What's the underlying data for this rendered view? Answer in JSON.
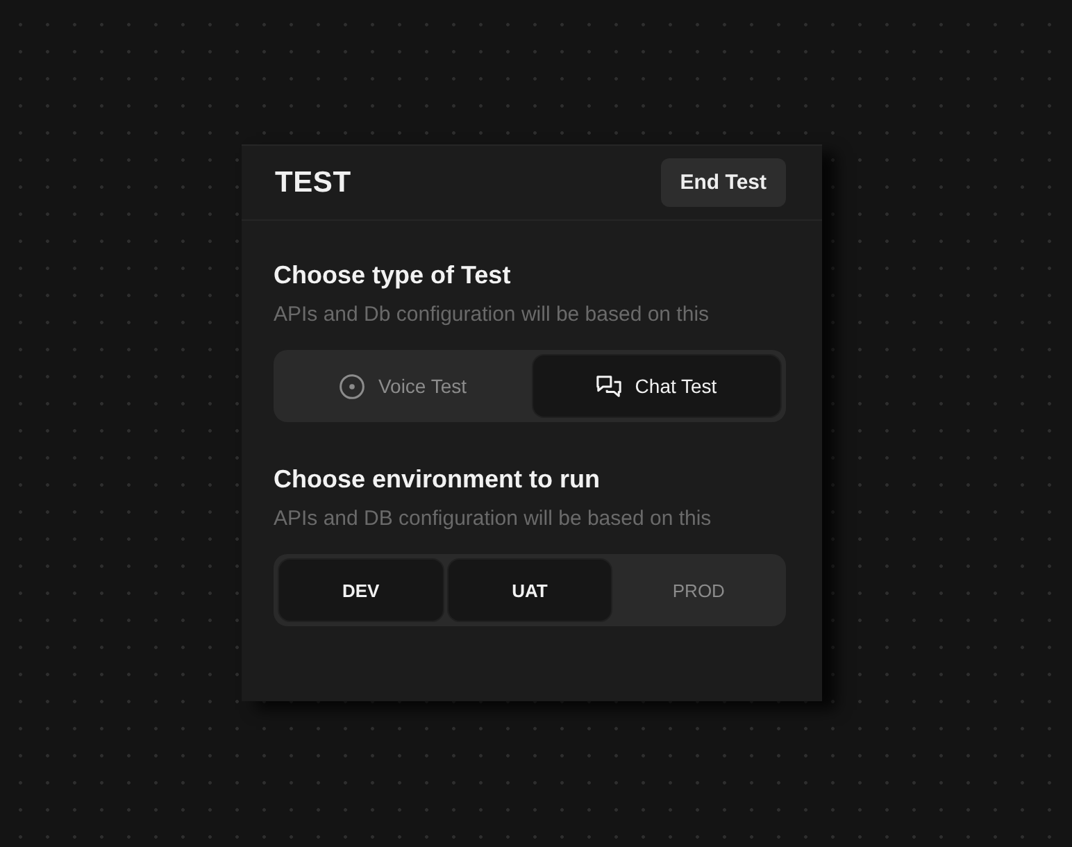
{
  "panel": {
    "title": "TEST",
    "end_button": "End Test"
  },
  "sections": [
    {
      "title": "Choose type of Test",
      "subtitle": "APIs and Db configuration will be based on this",
      "options": [
        {
          "label": "Voice Test",
          "kind": "voice",
          "selected": false
        },
        {
          "label": "Chat Test",
          "kind": "chat",
          "selected": true
        }
      ]
    },
    {
      "title": "Choose environment to run",
      "subtitle": "APIs and DB configuration will be based on this",
      "options": [
        {
          "label": "DEV",
          "selected": true
        },
        {
          "label": "UAT",
          "selected": true
        },
        {
          "label": "PROD",
          "selected": false
        }
      ]
    }
  ]
}
